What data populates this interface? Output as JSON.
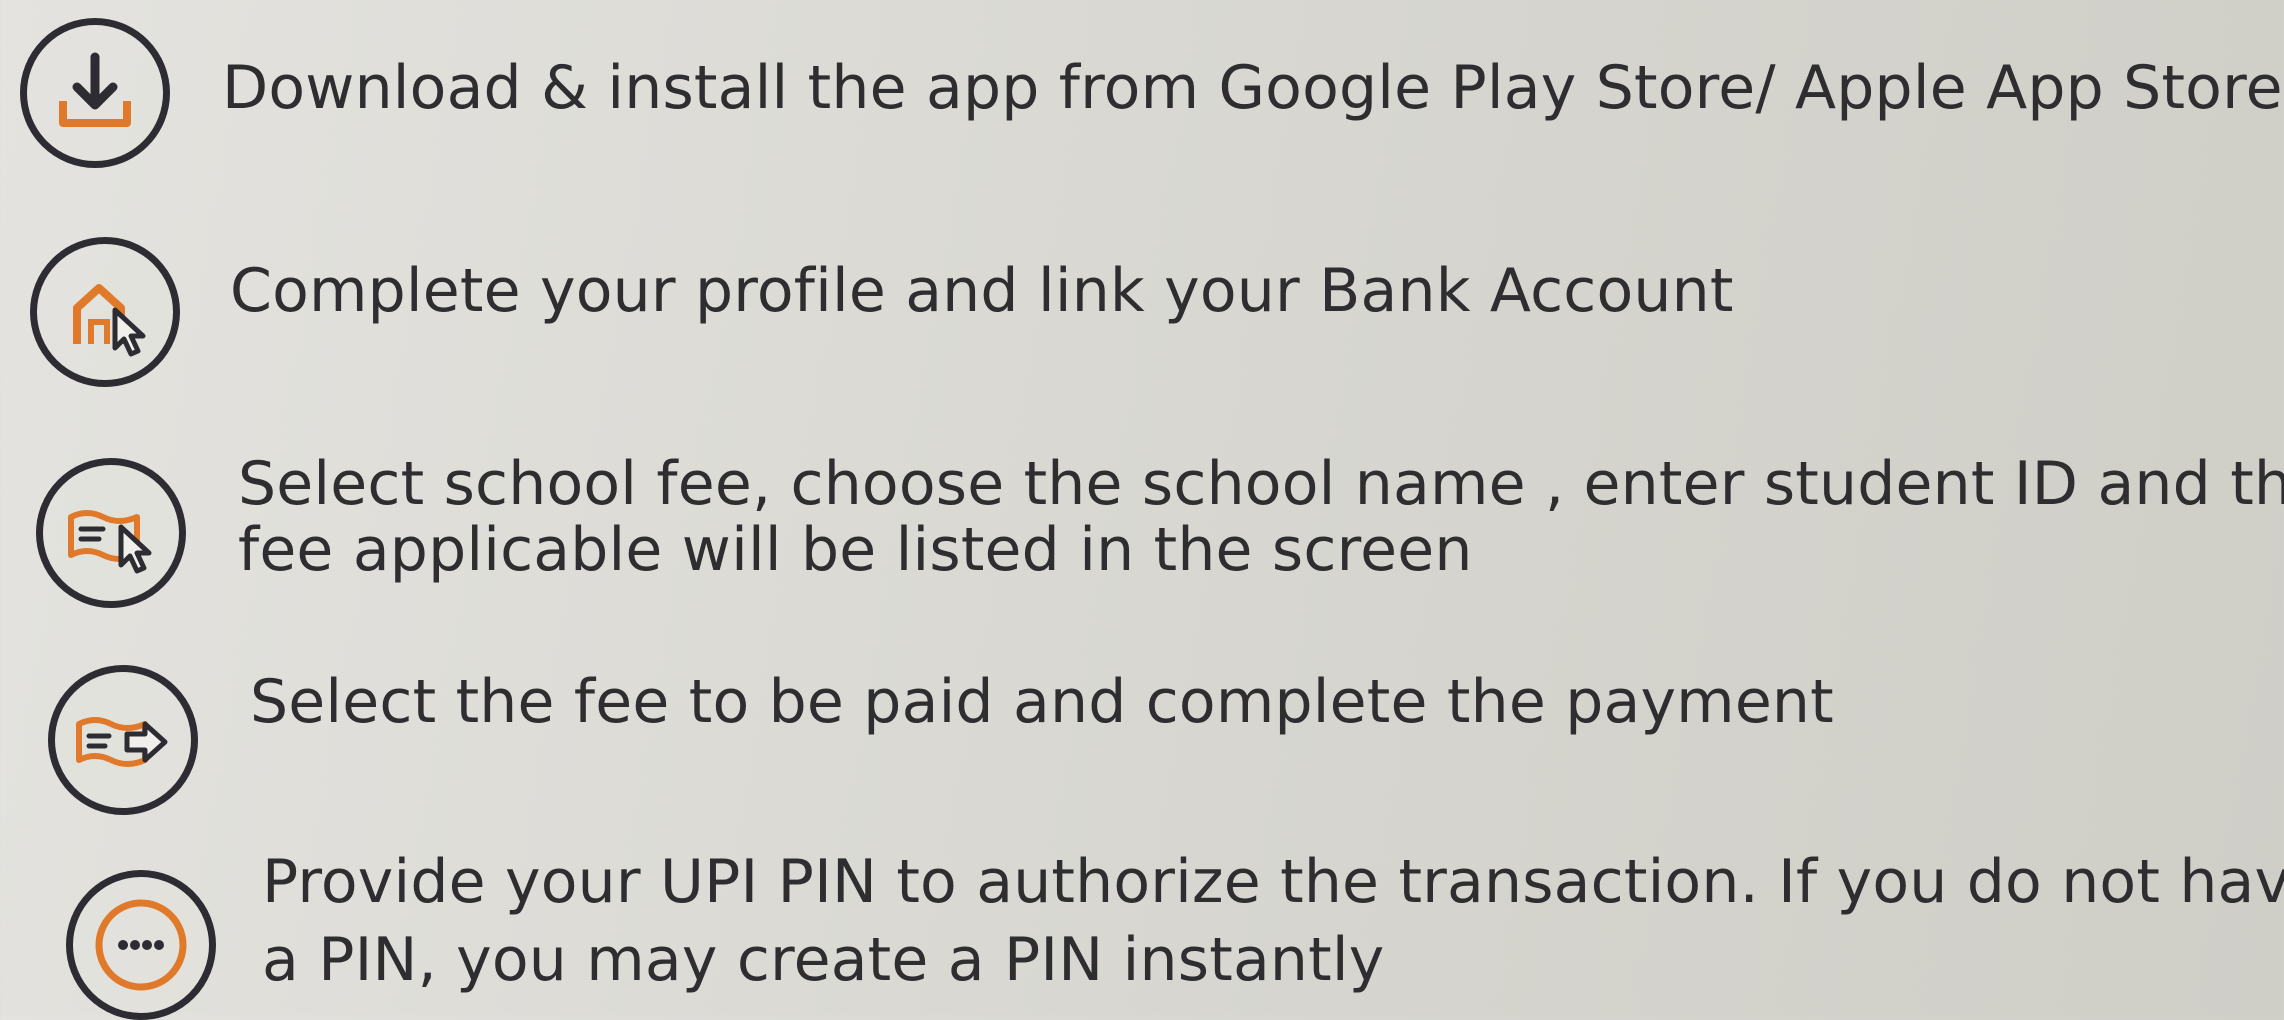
{
  "steps": [
    {
      "icon": "download-icon",
      "text": "Download & install the app from Google Play Store/ Apple App Store"
    },
    {
      "icon": "profile-bank-icon",
      "text": "Complete your profile and link your Bank Account"
    },
    {
      "icon": "school-fee-icon",
      "lines": [
        "Select school fee, choose the school name , enter student ID and the",
        "fee applicable will be listed in the screen"
      ]
    },
    {
      "icon": "pay-fee-icon",
      "text": "Select the fee to be paid and complete the payment"
    },
    {
      "icon": "upi-pin-icon",
      "lines": [
        "Provide your UPI PIN to authorize the transaction. If you do not have",
        "a PIN, you may create a PIN instantly"
      ]
    }
  ],
  "colors": {
    "accent": "#e07a2a",
    "outline": "#2d2c33",
    "text": "#2e2d30"
  }
}
